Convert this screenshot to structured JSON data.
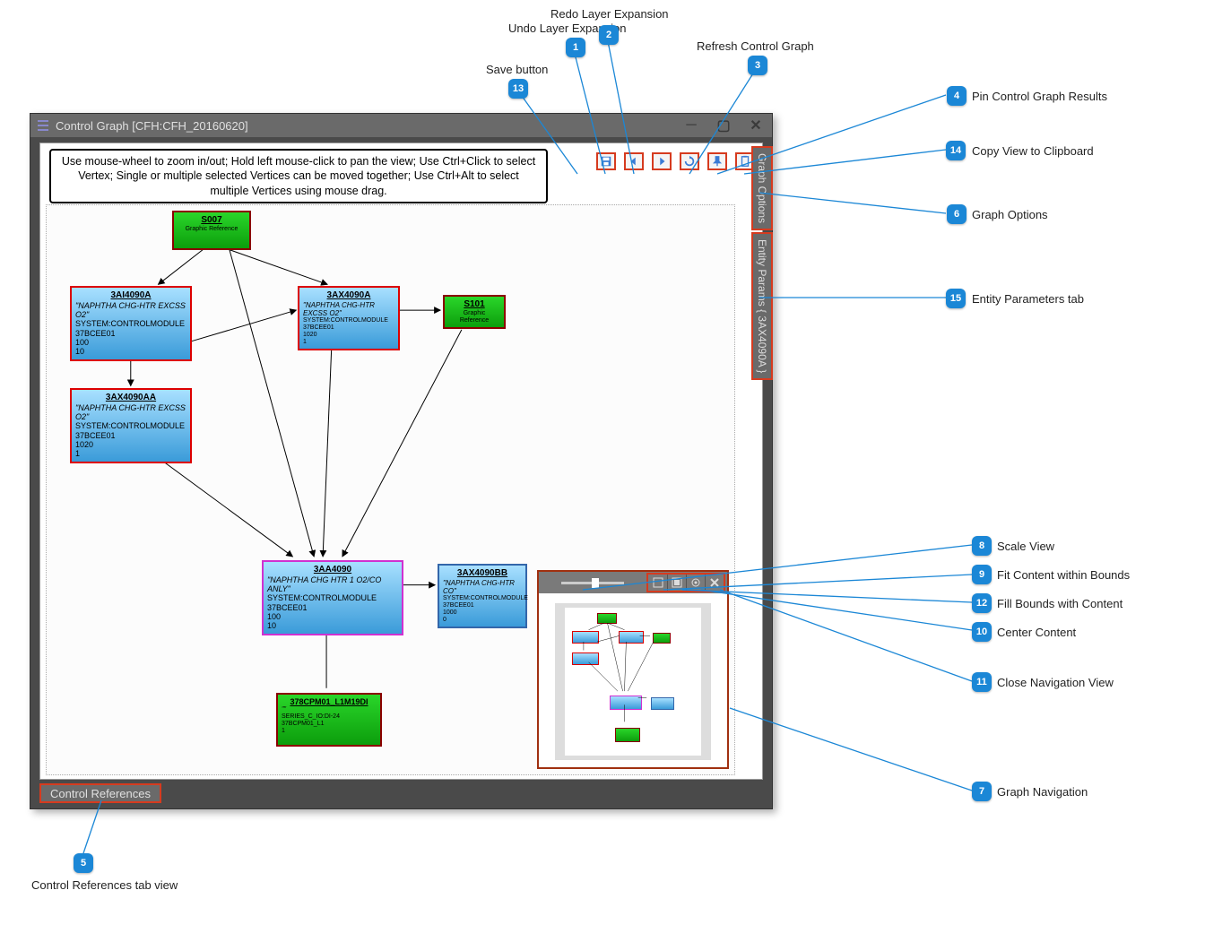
{
  "window": {
    "title": "Control Graph [CFH:CFH_20160620]"
  },
  "instruction": "Use mouse-wheel to zoom in/out; Hold left mouse-click to pan the view; Use Ctrl+Click to select Vertex; Single or multiple selected Vertices can be moved together; Use Ctrl+Alt to select multiple Vertices using mouse drag.",
  "bottom_tab": "Control References",
  "side_tabs": {
    "graph_options": "Graph Options",
    "entity_params": "Entity Params { 3AX4090A }"
  },
  "toolbar": {
    "save": "save-icon",
    "undo": "undo-layer-icon",
    "redo": "redo-layer-icon",
    "refresh": "refresh-icon",
    "pin": "pin-icon",
    "copy": "copy-clipboard-icon"
  },
  "nodes": {
    "s007": {
      "title": "S007",
      "sub": "Graphic Reference"
    },
    "n3ai4090a": {
      "title": "3AI4090A",
      "desc": "\"NAPHTHA CHG-HTR EXCSS O2\"",
      "sys": "SYSTEM:CONTROLMODULE",
      "l1": "37BCEE01",
      "l2": "100",
      "l3": "10"
    },
    "n3ax4090a": {
      "title": "3AX4090A",
      "desc": "\"NAPHTHA CHG-HTR EXCSS O2\"",
      "sys": "SYSTEM:CONTROLMODULE",
      "l1": "37BCEE01",
      "l2": "1020",
      "l3": "1"
    },
    "s101": {
      "title": "S101",
      "sub": "Graphic Reference"
    },
    "n3ax4090aa": {
      "title": "3AX4090AA",
      "desc": "\"NAPHTHA CHG-HTR EXCSS O2\"",
      "sys": "SYSTEM:CONTROLMODULE",
      "l1": "37BCEE01",
      "l2": "1020",
      "l3": "1"
    },
    "n3aa4090": {
      "title": "3AA4090",
      "desc": "\"NAPHTHA CHG HTR 1 O2/CO ANLY\"",
      "sys": "SYSTEM:CONTROLMODULE",
      "l1": "37BCEE01",
      "l2": "100",
      "l3": "10"
    },
    "n3ax4090bb": {
      "title": "3AX4090BB",
      "desc": "\"NAPHTHA CHG-HTR CO\"",
      "sys": "SYSTEM:CONTROLMODULE",
      "l1": "37BCEE01",
      "l2": "1000",
      "l3": "0"
    },
    "n378cpm01": {
      "title": "378CPM01_L1M19DI",
      "desc": "\"\"",
      "sys": "SERIES_C_IO:DI-24",
      "l1": "37BCPM01_L1",
      "l2": "1"
    }
  },
  "callouts": {
    "c1": {
      "num": "1",
      "label": "Undo Layer Expansion"
    },
    "c2": {
      "num": "2",
      "label": "Redo Layer Expansion"
    },
    "c3": {
      "num": "3",
      "label": "Refresh Control Graph"
    },
    "c4": {
      "num": "4",
      "label": "Pin Control Graph Results"
    },
    "c5": {
      "num": "5",
      "label": "Control References tab view"
    },
    "c6": {
      "num": "6",
      "label": "Graph Options"
    },
    "c7": {
      "num": "7",
      "label": "Graph Navigation"
    },
    "c8": {
      "num": "8",
      "label": "Scale View"
    },
    "c9": {
      "num": "9",
      "label": "Fit Content within Bounds"
    },
    "c10": {
      "num": "10",
      "label": "Center Content"
    },
    "c11": {
      "num": "11",
      "label": "Close Navigation View"
    },
    "c12": {
      "num": "12",
      "label": "Fill Bounds with Content"
    },
    "c13": {
      "num": "13",
      "label": "Save button"
    },
    "c14": {
      "num": "14",
      "label": "Copy View to Clipboard"
    },
    "c15": {
      "num": "15",
      "label": "Entity Parameters tab"
    }
  }
}
